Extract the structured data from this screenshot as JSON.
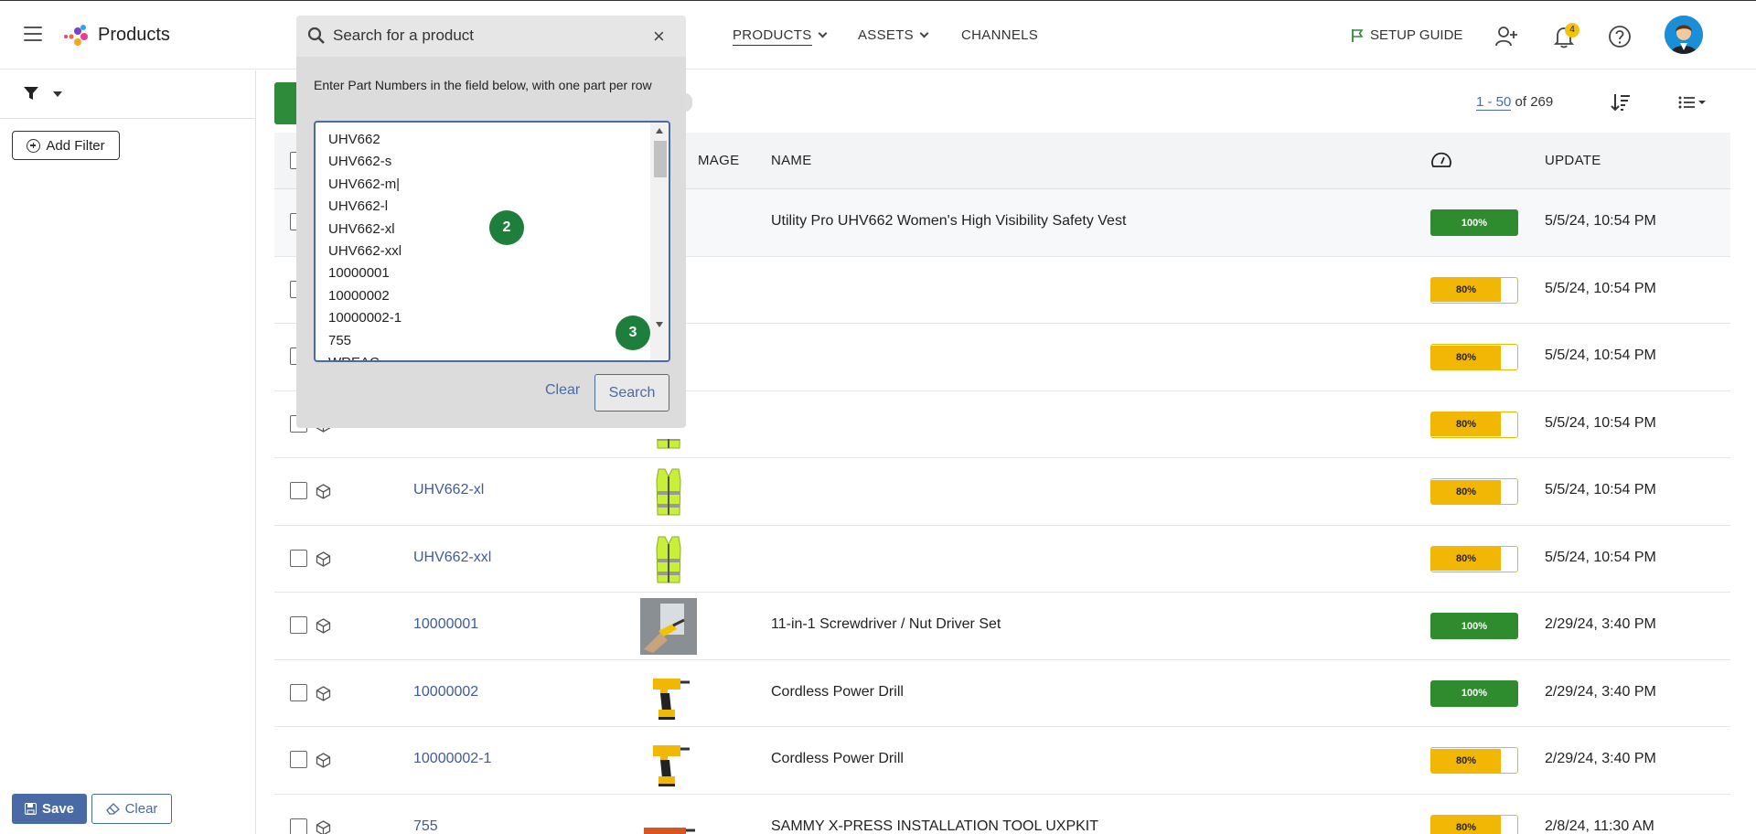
{
  "header": {
    "app_title": "Products",
    "nav": {
      "products": "PRODUCTS",
      "assets": "ASSETS",
      "channels": "CHANNELS"
    },
    "setup_guide": "SETUP GUIDE",
    "notification_count": "4"
  },
  "sidebar": {
    "add_filter_label": "Add Filter",
    "save_label": "Save",
    "clear_label": "Clear"
  },
  "search": {
    "placeholder": "Search for a product",
    "hint": "Enter Part Numbers in the field below, with one part per row",
    "part_lines": [
      "UHV662",
      "UHV662-s",
      "UHV662-m|",
      "UHV662-l",
      "UHV662-xl",
      "UHV662-xxl",
      "10000001",
      "10000002",
      "10000002-1",
      "755",
      "WREAC"
    ],
    "clear_label": "Clear",
    "search_label": "Search",
    "marker_2": "2",
    "marker_3": "3"
  },
  "pagination": {
    "range": "1 - 50",
    "total_text": " of 269"
  },
  "table": {
    "headers": {
      "image": "MAGE",
      "name": "NAME",
      "update": "UPDATE"
    },
    "rows": [
      {
        "part": "",
        "name": "Utility Pro UHV662 Women's High Visibility Safety Vest",
        "completeness": "100%",
        "pct": 100,
        "updated": "5/5/24, 10:54 PM",
        "thumb": "none"
      },
      {
        "part": "",
        "name": "",
        "completeness": "80%",
        "pct": 80,
        "updated": "5/5/24, 10:54 PM",
        "thumb": "none"
      },
      {
        "part": "",
        "name": "",
        "completeness": "80%",
        "pct": 80,
        "updated": "5/5/24, 10:54 PM",
        "thumb": "none"
      },
      {
        "part": "",
        "name": "",
        "completeness": "80%",
        "pct": 80,
        "updated": "5/5/24, 10:54 PM",
        "thumb": "vest-partial"
      },
      {
        "part": "UHV662-xl",
        "name": "",
        "completeness": "80%",
        "pct": 80,
        "updated": "5/5/24, 10:54 PM",
        "thumb": "vest"
      },
      {
        "part": "UHV662-xxl",
        "name": "",
        "completeness": "80%",
        "pct": 80,
        "updated": "5/5/24, 10:54 PM",
        "thumb": "vest"
      },
      {
        "part": "10000001",
        "name": "11-in-1 Screwdriver / Nut Driver Set",
        "completeness": "100%",
        "pct": 100,
        "updated": "2/29/24, 3:40 PM",
        "thumb": "screwdriver"
      },
      {
        "part": "10000002",
        "name": "Cordless Power Drill",
        "completeness": "100%",
        "pct": 100,
        "updated": "2/29/24, 3:40 PM",
        "thumb": "drill"
      },
      {
        "part": "10000002-1",
        "name": "Cordless Power Drill",
        "completeness": "80%",
        "pct": 80,
        "updated": "2/29/24, 3:40 PM",
        "thumb": "drill"
      },
      {
        "part": "755",
        "name": "SAMMY X-PRESS INSTALLATION TOOL UXPKIT",
        "completeness": "80%",
        "pct": 80,
        "updated": "2/8/24, 11:30 AM",
        "thumb": "tool"
      }
    ]
  },
  "colors": {
    "brand_blue": "#4a6aa5",
    "green": "#2e8b2e",
    "amber": "#f2b705"
  }
}
